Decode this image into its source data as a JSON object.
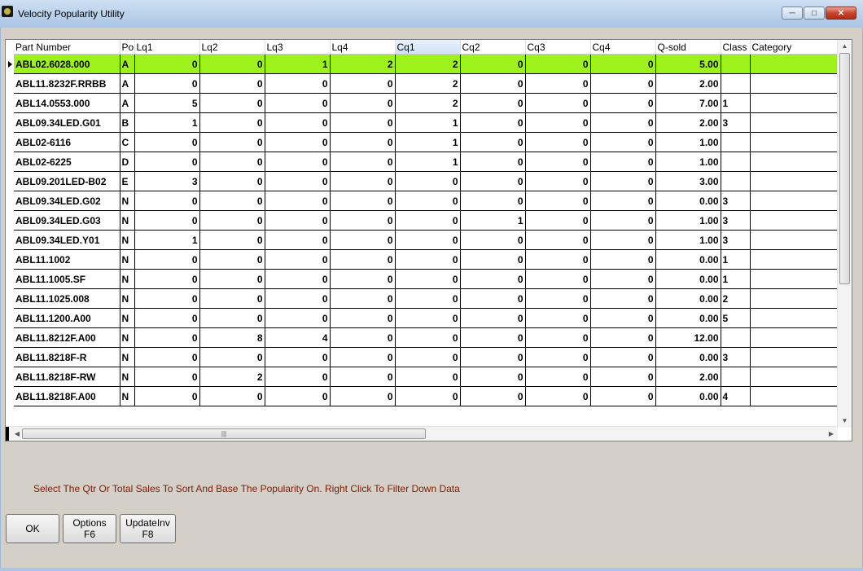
{
  "window": {
    "title": "Velocity Popularity Utility"
  },
  "columns": [
    "Part Number",
    "Po",
    "Lq1",
    "Lq2",
    "Lq3",
    "Lq4",
    "Cq1",
    "Cq2",
    "Cq3",
    "Cq4",
    "Q-sold",
    "Class",
    "Category"
  ],
  "rows": [
    [
      "ABL02.6028.000",
      "A",
      "0",
      "0",
      "1",
      "2",
      "2",
      "0",
      "0",
      "0",
      "5.00",
      "",
      ""
    ],
    [
      "ABL11.8232F.RRBB",
      "A",
      "0",
      "0",
      "0",
      "0",
      "2",
      "0",
      "0",
      "0",
      "2.00",
      "",
      ""
    ],
    [
      "ABL14.0553.000",
      "A",
      "5",
      "0",
      "0",
      "0",
      "2",
      "0",
      "0",
      "0",
      "7.00",
      "1",
      ""
    ],
    [
      "ABL09.34LED.G01",
      "B",
      "1",
      "0",
      "0",
      "0",
      "1",
      "0",
      "0",
      "0",
      "2.00",
      "3",
      ""
    ],
    [
      "ABL02-6116",
      "C",
      "0",
      "0",
      "0",
      "0",
      "1",
      "0",
      "0",
      "0",
      "1.00",
      "",
      ""
    ],
    [
      "ABL02-6225",
      "D",
      "0",
      "0",
      "0",
      "0",
      "1",
      "0",
      "0",
      "0",
      "1.00",
      "",
      ""
    ],
    [
      "ABL09.201LED-B02",
      "E",
      "3",
      "0",
      "0",
      "0",
      "0",
      "0",
      "0",
      "0",
      "3.00",
      "",
      ""
    ],
    [
      "ABL09.34LED.G02",
      "N",
      "0",
      "0",
      "0",
      "0",
      "0",
      "0",
      "0",
      "0",
      "0.00",
      "3",
      ""
    ],
    [
      "ABL09.34LED.G03",
      "N",
      "0",
      "0",
      "0",
      "0",
      "0",
      "1",
      "0",
      "0",
      "1.00",
      "3",
      ""
    ],
    [
      "ABL09.34LED.Y01",
      "N",
      "1",
      "0",
      "0",
      "0",
      "0",
      "0",
      "0",
      "0",
      "1.00",
      "3",
      ""
    ],
    [
      "ABL11.1002",
      "N",
      "0",
      "0",
      "0",
      "0",
      "0",
      "0",
      "0",
      "0",
      "0.00",
      "1",
      ""
    ],
    [
      "ABL11.1005.SF",
      "N",
      "0",
      "0",
      "0",
      "0",
      "0",
      "0",
      "0",
      "0",
      "0.00",
      "1",
      ""
    ],
    [
      "ABL11.1025.008",
      "N",
      "0",
      "0",
      "0",
      "0",
      "0",
      "0",
      "0",
      "0",
      "0.00",
      "2",
      ""
    ],
    [
      "ABL11.1200.A00",
      "N",
      "0",
      "0",
      "0",
      "0",
      "0",
      "0",
      "0",
      "0",
      "0.00",
      "5",
      ""
    ],
    [
      "ABL11.8212F.A00",
      "N",
      "0",
      "8",
      "4",
      "0",
      "0",
      "0",
      "0",
      "0",
      "12.00",
      "",
      ""
    ],
    [
      "ABL11.8218F-R",
      "N",
      "0",
      "0",
      "0",
      "0",
      "0",
      "0",
      "0",
      "0",
      "0.00",
      "3",
      ""
    ],
    [
      "ABL11.8218F-RW",
      "N",
      "0",
      "2",
      "0",
      "0",
      "0",
      "0",
      "0",
      "0",
      "2.00",
      "",
      ""
    ],
    [
      "ABL11.8218F.A00",
      "N",
      "0",
      "0",
      "0",
      "0",
      "0",
      "0",
      "0",
      "0",
      "0.00",
      "4",
      ""
    ]
  ],
  "hint": "Select The Qtr Or Total Sales To Sort And Base The Popularity On.  Right Click To Filter Down Data",
  "buttons": {
    "ok": "OK",
    "options": "Options",
    "options_key": "F6",
    "update": "UpdateInv",
    "update_key": "F8"
  },
  "colors": {
    "selected_row": "#9ef21c",
    "hint_text": "#7a1a0d"
  }
}
